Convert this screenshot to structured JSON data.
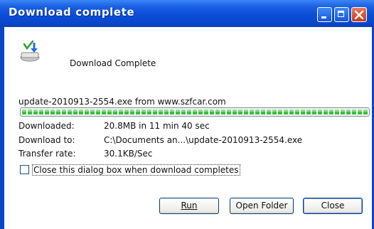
{
  "window": {
    "title": "Download complete"
  },
  "dialog": {
    "heading": "Download Complete",
    "filename_source": "update-2010913-2554.exe from www.szfcar.com",
    "progress_fraction": 1.0,
    "details": [
      {
        "label": "Downloaded:",
        "value": "20.8MB in 11 min 40 sec"
      },
      {
        "label": "Download to:",
        "value": "C:\\Documents an...\\update-2010913-2554.exe"
      },
      {
        "label": "Transfer rate:",
        "value": "30.1KB/Sec"
      }
    ],
    "close_checkbox": {
      "label": "Close this dialog box when download completes",
      "checked": false
    }
  },
  "buttons": {
    "run": "Run",
    "open_folder": "Open Folder",
    "close": "Close"
  },
  "icons": {
    "title_minimize": "minimize-icon",
    "title_maximize": "maximize-icon",
    "title_close": "close-icon",
    "download": "download-complete-icon"
  },
  "colors": {
    "titlebar": "#0b4ed6",
    "progress": "#37c23a"
  }
}
